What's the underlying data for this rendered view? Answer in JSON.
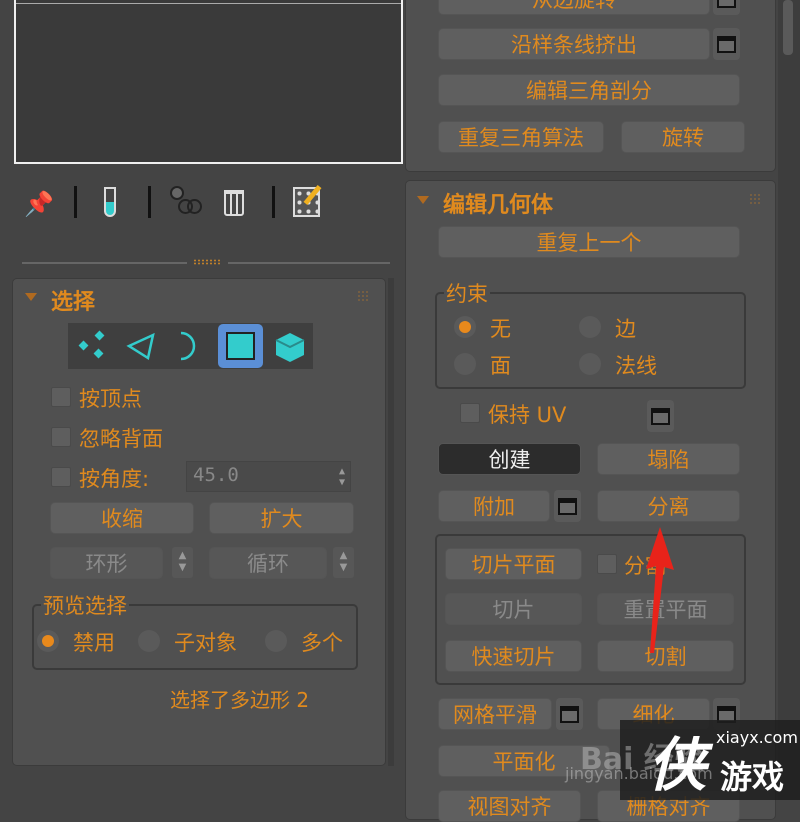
{
  "top_panel": {
    "buttons": [
      "从边旋转",
      "沿样条线挤出",
      "编辑三角剖分",
      "重复三角算法",
      "旋转"
    ]
  },
  "toolbar": {
    "icons": [
      "pin-icon",
      "test-tube-icon",
      "object-group-icon",
      "trash-icon",
      "edit-config-icon"
    ]
  },
  "selection": {
    "title": "选择",
    "levels": [
      "vertex",
      "edge",
      "border",
      "polygon",
      "element"
    ],
    "active_level": "polygon",
    "by_vertex": "按顶点",
    "ignore_backfacing": "忽略背面",
    "by_angle": "按角度:",
    "angle_value": "45.0",
    "shrink": "收缩",
    "grow": "扩大",
    "ring": "环形",
    "loop": "循环",
    "preview_title": "预览选择",
    "preview_options": [
      "禁用",
      "子对象",
      "多个"
    ],
    "preview_selected": "禁用",
    "status": "选择了多边形 2"
  },
  "edit_geometry": {
    "title": "编辑几何体",
    "repeat_last": "重复上一个",
    "constraints_title": "约束",
    "constraints": [
      "无",
      "边",
      "面",
      "法线"
    ],
    "constraint_selected": "无",
    "preserve_uv": "保持 UV",
    "create": "创建",
    "collapse": "塌陷",
    "attach": "附加",
    "detach": "分离",
    "slice_plane": "切片平面",
    "split": "分割",
    "slice": "切片",
    "reset_plane": "重置平面",
    "quickslice": "快速切片",
    "cut": "切割",
    "meshsmooth": "网格平滑",
    "tessellate": "细化",
    "make_planar": "平面化",
    "view_align": "视图对齐",
    "grid_align": "栅格对齐"
  },
  "watermark": {
    "site": "xiayx.com",
    "logo_char": "侠",
    "logo_text": "游戏",
    "baidu": "Bai 经验",
    "baidu_url": "jingyan.baidu.com"
  },
  "colors": {
    "accent": "#e08a1e",
    "annotation_arrow": "#e8231a",
    "selected_level": "#5b8fd6"
  }
}
